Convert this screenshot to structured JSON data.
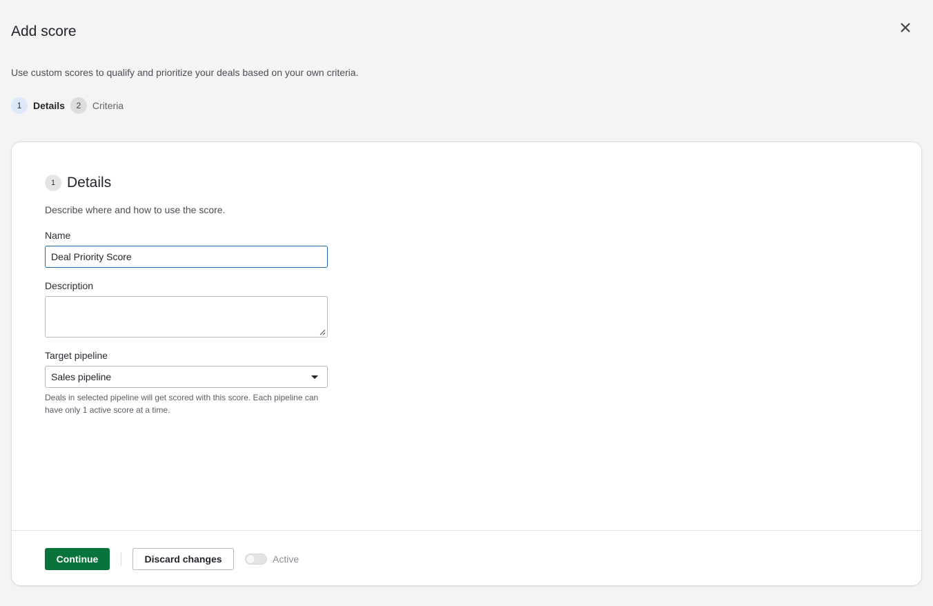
{
  "header": {
    "title": "Add score",
    "intro": "Use custom scores to qualify and prioritize your deals based on your own criteria.",
    "close_icon": "close-icon"
  },
  "stepper": {
    "steps": [
      {
        "number": "1",
        "label": "Details",
        "active": true
      },
      {
        "number": "2",
        "label": "Criteria",
        "active": false
      }
    ]
  },
  "details": {
    "section_number": "1",
    "section_title": "Details",
    "section_description": "Describe where and how to use the score.",
    "name_label": "Name",
    "name_value": "Deal Priority Score",
    "description_label": "Description",
    "description_value": "",
    "pipeline_label": "Target pipeline",
    "pipeline_value": "Sales pipeline",
    "pipeline_help": "Deals in selected pipeline will get scored with this score. Each pipeline can have only 1 active score at a time."
  },
  "footer": {
    "continue_label": "Continue",
    "discard_label": "Discard changes",
    "active_label": "Active",
    "active_on": false
  },
  "colors": {
    "primary": "#08743b",
    "focus_border": "#1f68b0",
    "active_step_bg": "#dde8f8"
  }
}
